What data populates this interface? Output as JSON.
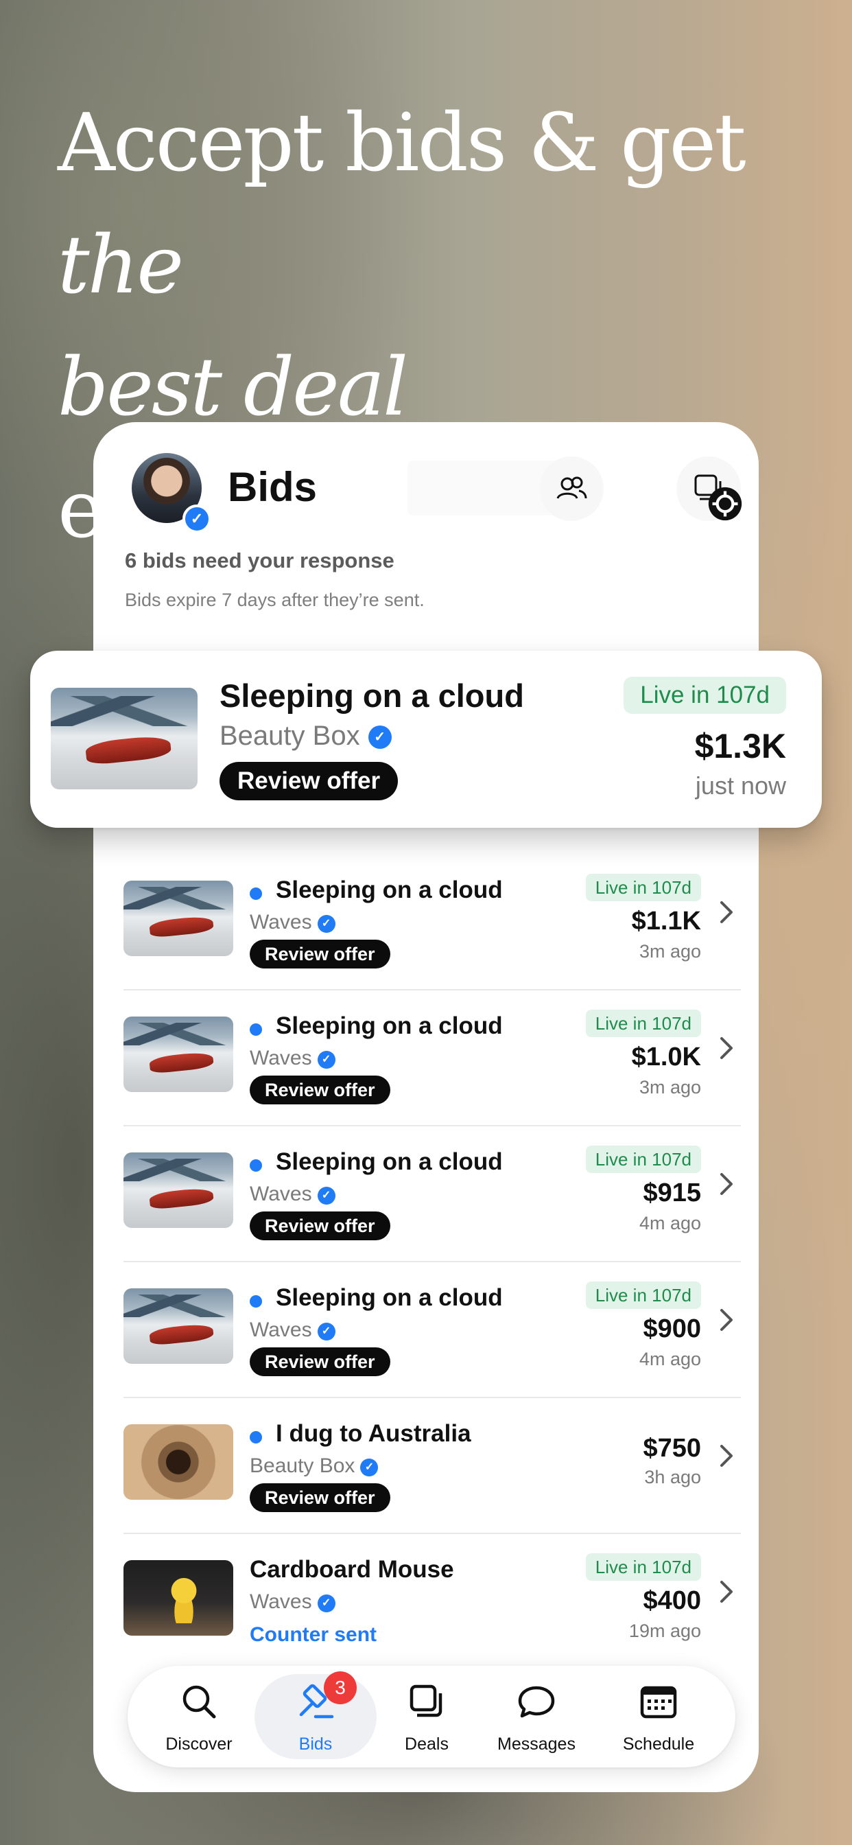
{
  "headline": {
    "line1_regular": "Accept bids & get ",
    "line1_italic": "the",
    "line2_italic": "best deal",
    "line2_regular": " everytime"
  },
  "header": {
    "title": "Bids",
    "pending_text": "6 bids need your response",
    "expire_text": "Bids expire 7 days after they’re sent."
  },
  "featured_bid": {
    "title": "Sleeping on a cloud",
    "brand": "Beauty Box",
    "action": "Review offer",
    "status": "Live in 107d",
    "price": "$1.3K",
    "time": "just now"
  },
  "bids": [
    {
      "title": "Sleeping on a cloud",
      "brand": "Waves",
      "action": "Review offer",
      "status": "Live in 107d",
      "price": "$1.1K",
      "time": "3m ago"
    },
    {
      "title": "Sleeping on a cloud",
      "brand": "Waves",
      "action": "Review offer",
      "status": "Live in 107d",
      "price": "$1.0K",
      "time": "3m ago"
    },
    {
      "title": "Sleeping on a cloud",
      "brand": "Waves",
      "action": "Review offer",
      "status": "Live in 107d",
      "price": "$915",
      "time": "4m ago"
    },
    {
      "title": "Sleeping on a cloud",
      "brand": "Waves",
      "action": "Review offer",
      "status": "Live in 107d",
      "price": "$900",
      "time": "4m ago"
    },
    {
      "title": "I dug to Australia",
      "brand": "Beauty Box",
      "action": "Review offer",
      "status": "",
      "price": "$750",
      "time": "3h ago"
    },
    {
      "title": "Cardboard Mouse",
      "brand": "Waves",
      "action": "Counter sent",
      "status": "Live in 107d",
      "price": "$400",
      "time": "19m ago"
    }
  ],
  "tabs": [
    {
      "label": "Discover",
      "icon": "search-icon"
    },
    {
      "label": "Bids",
      "icon": "gavel-icon",
      "badge": "3"
    },
    {
      "label": "Deals",
      "icon": "cards-icon"
    },
    {
      "label": "Messages",
      "icon": "chat-bubble-icon"
    },
    {
      "label": "Schedule",
      "icon": "calendar-icon"
    }
  ],
  "colors": {
    "accent": "#1f7bf6",
    "live_bg": "#e2f4ea",
    "live_text": "#1f8b4c",
    "badge": "#ef3a3a"
  }
}
